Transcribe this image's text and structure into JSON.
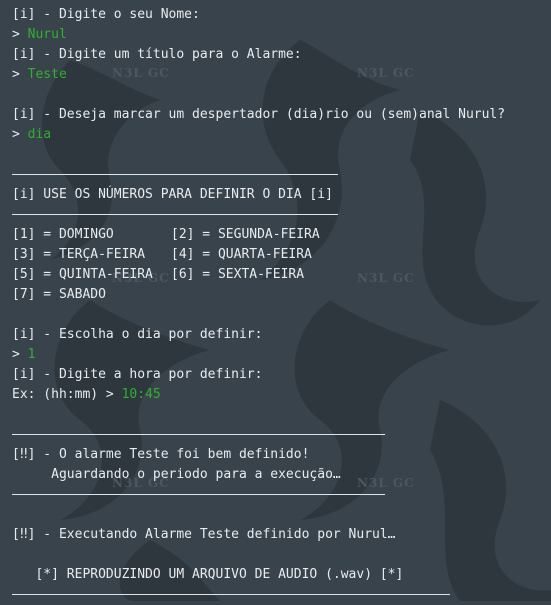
{
  "watermark": "N3L GC",
  "colors": {
    "background": "#39434b",
    "input": "#2fb02f",
    "text": "#e8ecef"
  },
  "lines": {
    "ask_name": "[i] - Digite o seu Nome:",
    "prompt": "> ",
    "name_value": "Nurul",
    "ask_title": "[i] - Digite um título para o Alarme:",
    "title_value": "Teste",
    "ask_type": "[i] - Deseja marcar um despertador (dia)rio ou (sem)anal Nurul?",
    "type_value": "dia",
    "use_numbers": "[i] USE OS NÚMEROS PARA DEFINIR O DIA [i]",
    "days": [
      [
        "[1] = DOMINGO",
        "[2] = SEGUNDA-FEIRA"
      ],
      [
        "[3] = TERÇA-FEIRA",
        "[4] = QUARTA-FEIRA"
      ],
      [
        "[5] = QUINTA-FEIRA",
        "[6] = SEXTA-FEIRA"
      ],
      [
        "[7] = SABADO",
        ""
      ]
    ],
    "ask_day": "[i] - Escolha o dia por definir:",
    "day_value": "1",
    "ask_hour": "[i] - Digite a hora por definir:",
    "hour_example": "Ex: (hh:mm) > ",
    "hour_value": "10:45",
    "defined": "[‼] - O alarme Teste foi bem definido!",
    "waiting": "     Aguardando o periodo para a execução…",
    "executing": "[‼] - Executando Alarme Teste definido por Nurul…",
    "playing": "   [*] REPRODUZINDO UM ARQUIVO DE AUDIO (.wav) [*]"
  }
}
